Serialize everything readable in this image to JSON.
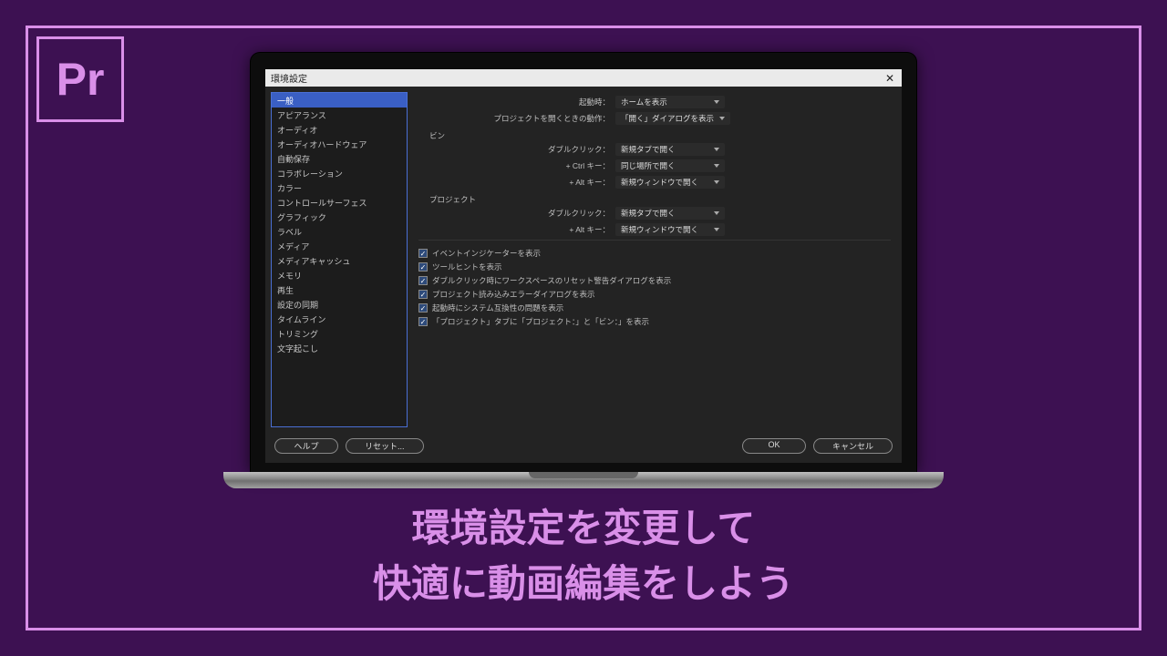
{
  "logo": {
    "label": "Pr"
  },
  "dialog": {
    "title": "環境設定",
    "sidebar": {
      "items": [
        "一般",
        "アピアランス",
        "オーディオ",
        "オーディオハードウェア",
        "自動保存",
        "コラボレーション",
        "カラー",
        "コントロールサーフェス",
        "グラフィック",
        "ラベル",
        "メディア",
        "メディアキャッシュ",
        "メモリ",
        "再生",
        "設定の同期",
        "タイムライン",
        "トリミング",
        "文字起こし"
      ],
      "active_index": 0
    },
    "main": {
      "rows_top": [
        {
          "label": "起動時：",
          "value": "ホームを表示"
        },
        {
          "label": "プロジェクトを開くときの動作：",
          "value": "「開く」ダイアログを表示"
        }
      ],
      "section_bin": "ビン",
      "rows_bin": [
        {
          "label": "ダブルクリック：",
          "value": "新規タブで開く"
        },
        {
          "label": "+ Ctrl キー：",
          "value": "同じ場所で開く"
        },
        {
          "label": "+ Alt キー：",
          "value": "新規ウィンドウで開く"
        }
      ],
      "section_project": "プロジェクト",
      "rows_project": [
        {
          "label": "ダブルクリック：",
          "value": "新規タブで開く"
        },
        {
          "label": "+ Alt キー：",
          "value": "新規ウィンドウで開く"
        }
      ],
      "checks": [
        "イベントインジケーターを表示",
        "ツールヒントを表示",
        "ダブルクリック時にワークスペースのリセット警告ダイアログを表示",
        "プロジェクト読み込みエラーダイアログを表示",
        "起動時にシステム互換性の問題を表示",
        "「プロジェクト」タブに「プロジェクト：」と「ビン：」を表示"
      ]
    },
    "buttons": {
      "help": "ヘルプ",
      "reset": "リセット...",
      "ok": "OK",
      "cancel": "キャンセル"
    }
  },
  "caption": {
    "line1": "環境設定を変更して",
    "line2": "快適に動画編集をしよう"
  }
}
